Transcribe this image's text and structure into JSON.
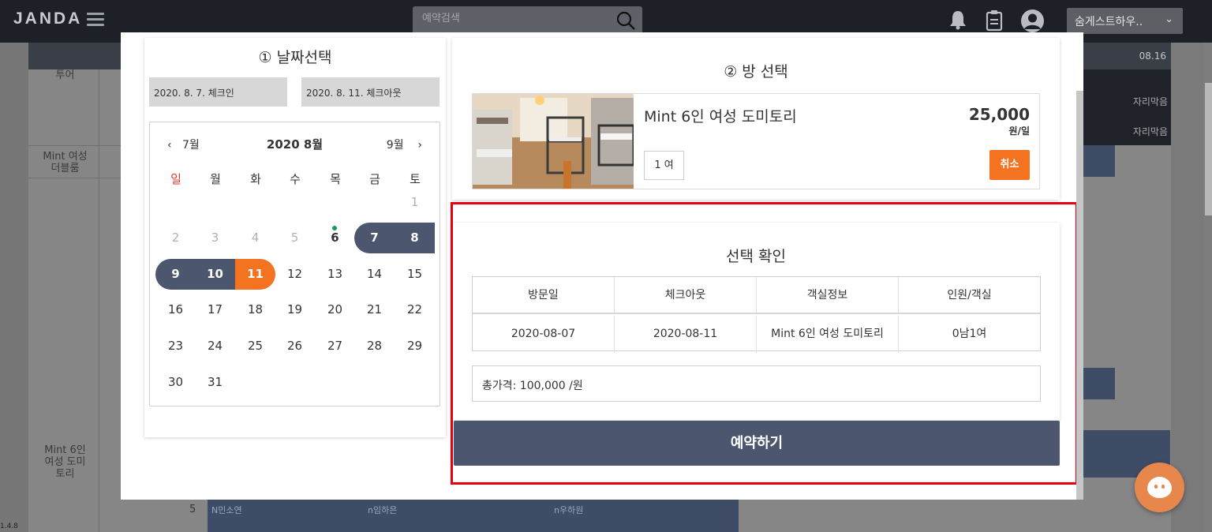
{
  "app": {
    "logo": "JANDA",
    "search_placeholder": "예약검색",
    "account_label": "숨게스트하우..",
    "version": "1.4.8",
    "header_date": "08.16",
    "bg_rows": [
      "투어",
      "Mint 여성\n더블룸",
      "Mint 6인\n여성 도미\n토리"
    ],
    "bg_status": [
      "자리막음",
      "자리막음"
    ],
    "bg_bottom_number": "5",
    "bg_bookings": [
      "N민소연",
      "n임하은",
      "n우하원"
    ]
  },
  "date_panel": {
    "title": "① 날짜선택",
    "checkin": "2020. 8. 7. 체크인",
    "checkout": "2020. 8. 11. 체크아웃",
    "calendar": {
      "prev_month": "7월",
      "next_month": "9월",
      "title": "2020  8월",
      "weekdays": [
        "일",
        "월",
        "화",
        "수",
        "목",
        "금",
        "토"
      ],
      "weeks": [
        [
          "",
          "",
          "",
          "",
          "",
          "",
          "1"
        ],
        [
          "2",
          "3",
          "4",
          "5",
          "6",
          "7",
          "8"
        ],
        [
          "9",
          "10",
          "11",
          "12",
          "13",
          "14",
          "15"
        ],
        [
          "16",
          "17",
          "18",
          "19",
          "20",
          "21",
          "22"
        ],
        [
          "23",
          "24",
          "25",
          "26",
          "27",
          "28",
          "29"
        ],
        [
          "30",
          "31",
          "",
          "",
          "",
          "",
          ""
        ]
      ]
    }
  },
  "room_panel": {
    "title": "② 방 선택",
    "room_name": "Mint 6인 여성 도미토리",
    "price": "25,000",
    "price_unit": "원/일",
    "guests": "1 여",
    "cancel_label": "취소"
  },
  "confirm_panel": {
    "title": "선택 확인",
    "headers": [
      "방문일",
      "체크아웃",
      "객실정보",
      "인원/객실"
    ],
    "row": [
      "2020-08-07",
      "2020-08-11",
      "Mint 6인 여성 도미토리",
      "0남1여"
    ],
    "total": "총가격: 100,000 /원",
    "reserve_label": "예약하기"
  },
  "colors": {
    "accent_orange": "#f47321",
    "selection_navy": "#4c566e",
    "highlight_red": "#e60012",
    "sunday_red": "#e53935"
  }
}
